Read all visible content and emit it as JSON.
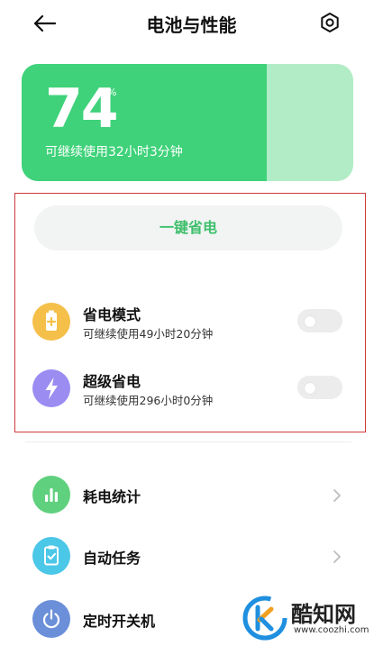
{
  "header": {
    "title": "电池与性能",
    "back_icon": "arrow-left-icon",
    "settings_icon": "hexagon-gear-icon"
  },
  "battery": {
    "percent": "74",
    "percent_sign": "%",
    "level": 0.74,
    "remaining": "可继续使用32小时3分钟",
    "colors": {
      "fill": "#3fd27a",
      "empty": "#b2ecc6"
    }
  },
  "one_key_saver": {
    "label": "一键省电"
  },
  "modes": [
    {
      "title": "省电模式",
      "subtitle": "可继续使用49小时20分钟",
      "icon": "battery-plus-icon",
      "color": "#f5c04a",
      "enabled": false
    },
    {
      "title": "超级省电",
      "subtitle": "可继续使用296小时0分钟",
      "icon": "lightning-icon",
      "color": "#9b8cf2",
      "enabled": false
    }
  ],
  "menu": [
    {
      "label": "耗电统计",
      "icon": "bar-chart-icon",
      "color": "#5fd07e"
    },
    {
      "label": "自动任务",
      "icon": "clipboard-check-icon",
      "color": "#4bc7e8"
    },
    {
      "label": "定时开关机",
      "icon": "power-icon",
      "color": "#6b8fd9"
    }
  ],
  "watermark": {
    "text": "酷知网",
    "url": "www.coozhi.com"
  }
}
